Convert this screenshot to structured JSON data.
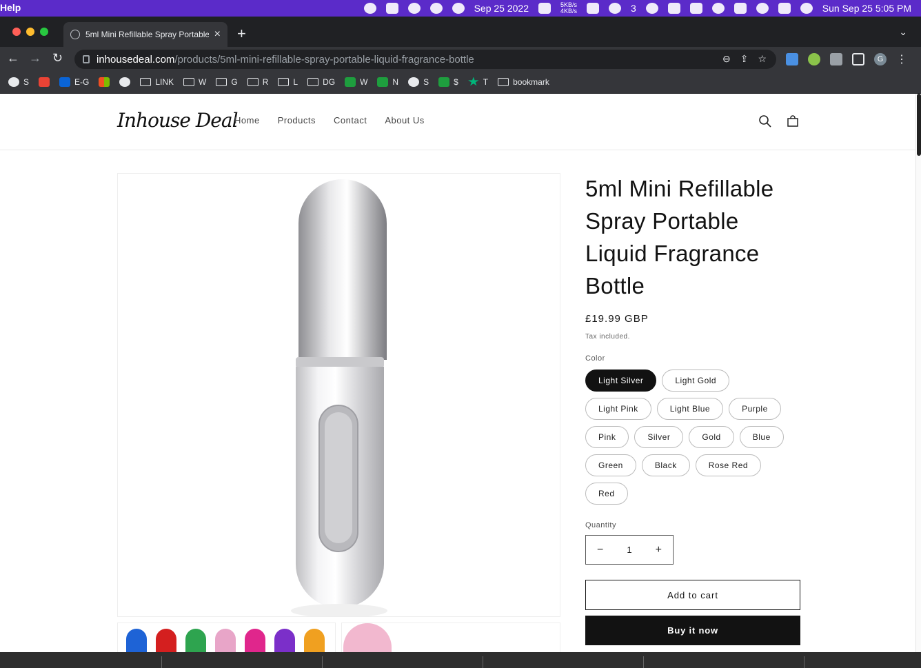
{
  "menubar": {
    "app_menu": "Help",
    "date_center": "Sep 25 2022",
    "net_up": "5KB/s",
    "net_down": "4KB/s",
    "wechat_count": "3",
    "clock": "Sun Sep 25  5:05 PM"
  },
  "browser": {
    "tab_title": "5ml Mini Refillable Spray Portable Liquid Fragrance Bottle",
    "url_domain": "inhousedeal.com",
    "url_path": "/products/5ml-mini-refillable-spray-portable-liquid-fragrance-bottle",
    "profile_initial": "G"
  },
  "bookmarks": [
    {
      "label": "S",
      "icon": "globe-icon"
    },
    {
      "label": "",
      "icon": "gmail-icon"
    },
    {
      "label": "E-G",
      "icon": "outlook-icon"
    },
    {
      "label": "",
      "icon": "microsoft-icon"
    },
    {
      "label": "",
      "icon": "globe-icon"
    },
    {
      "label": "LINK",
      "icon": "folder-icon"
    },
    {
      "label": "W",
      "icon": "folder-icon"
    },
    {
      "label": "G",
      "icon": "folder-icon"
    },
    {
      "label": "R",
      "icon": "folder-icon"
    },
    {
      "label": "L",
      "icon": "folder-icon"
    },
    {
      "label": "DG",
      "icon": "folder-icon"
    },
    {
      "label": "W",
      "icon": "green-cross-icon"
    },
    {
      "label": "N",
      "icon": "green-cross-icon"
    },
    {
      "label": "S",
      "icon": "globe-icon"
    },
    {
      "label": "$",
      "icon": "green-cross-icon"
    },
    {
      "label": "T",
      "icon": "star-icon"
    },
    {
      "label": "bookmark",
      "icon": "folder-icon"
    }
  ],
  "store": {
    "logo": "Inhouse Deal",
    "nav": [
      "Home",
      "Products",
      "Contact",
      "About Us"
    ]
  },
  "product": {
    "title": "5ml Mini Refillable Spray Portable Liquid Fragrance Bottle",
    "price": "£19.99 GBP",
    "tax_note": "Tax included.",
    "color_label": "Color",
    "colors": [
      "Light Silver",
      "Light Gold",
      "Light Pink",
      "Light Blue",
      "Purple",
      "Pink",
      "Silver",
      "Gold",
      "Blue",
      "Green",
      "Black",
      "Rose Red",
      "Red"
    ],
    "selected_color": "Light Silver",
    "quantity_label": "Quantity",
    "quantity": "1",
    "add_to_cart": "Add to cart",
    "buy_now": "Buy it now"
  },
  "colors": {
    "menubar": "#5b2bc9",
    "accent_dark": "#121212"
  }
}
